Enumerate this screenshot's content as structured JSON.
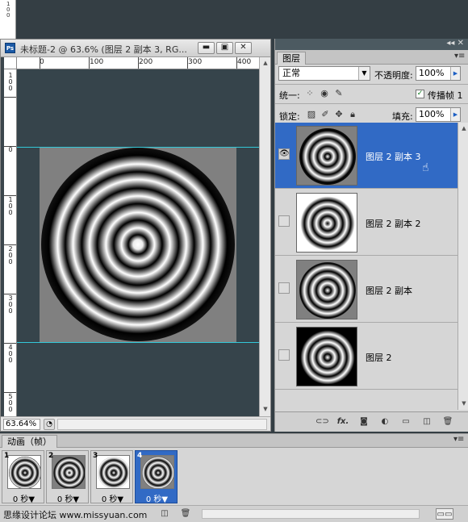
{
  "document": {
    "title": "未标题-2 @ 63.6% (图层 2 副本 3, RG...",
    "ps_badge": "Ps",
    "buttons": {
      "minimize": "▬",
      "restore": "▣",
      "close": "✕"
    },
    "hruler_labels": [
      "0",
      "100",
      "200",
      "300",
      "400"
    ],
    "vruler_labels": [
      "1\n0\n0",
      "0",
      "1\n0\n0",
      "2\n0\n0",
      "3\n0\n0",
      "4\n0\n0",
      "5\n0\n0"
    ],
    "zoom": "63.64%"
  },
  "top_ruler_labels": [
    "1\n0\n0"
  ],
  "layers_panel": {
    "tab": "图层",
    "blend_mode": "正常",
    "opacity_label": "不透明度:",
    "opacity_value": "100%",
    "unify_label": "统一:",
    "propagate_label": "传播帧 1",
    "lock_label": "锁定:",
    "fill_label": "填充:",
    "fill_value": "100%",
    "layers": [
      {
        "name": "图层 2 副本 3",
        "selected": true,
        "visible": true,
        "bg": "#808080"
      },
      {
        "name": "图层 2 副本 2",
        "selected": false,
        "visible": false,
        "bg": "#ffffff"
      },
      {
        "name": "图层 2 副本",
        "selected": false,
        "visible": false,
        "bg": "#808080"
      },
      {
        "name": "图层 2",
        "selected": false,
        "visible": false,
        "bg": "#000000"
      }
    ],
    "bottom_icons": [
      "link-icon",
      "fx-icon",
      "mask-icon",
      "adjustment-icon",
      "group-icon",
      "new-layer-icon",
      "trash-icon"
    ]
  },
  "animation": {
    "tab": "动画（帧）",
    "frames": [
      {
        "num": "1",
        "delay": "0 秒▼",
        "selected": false,
        "bg": "#ffffff"
      },
      {
        "num": "2",
        "delay": "0 秒▼",
        "selected": false,
        "bg": "#808080"
      },
      {
        "num": "3",
        "delay": "0 秒▼",
        "selected": false,
        "bg": "#ffffff"
      },
      {
        "num": "4",
        "delay": "0 秒▼",
        "selected": true,
        "bg": "#808080"
      }
    ],
    "watermark": "思缘设计论坛 www.missyuan.com"
  }
}
